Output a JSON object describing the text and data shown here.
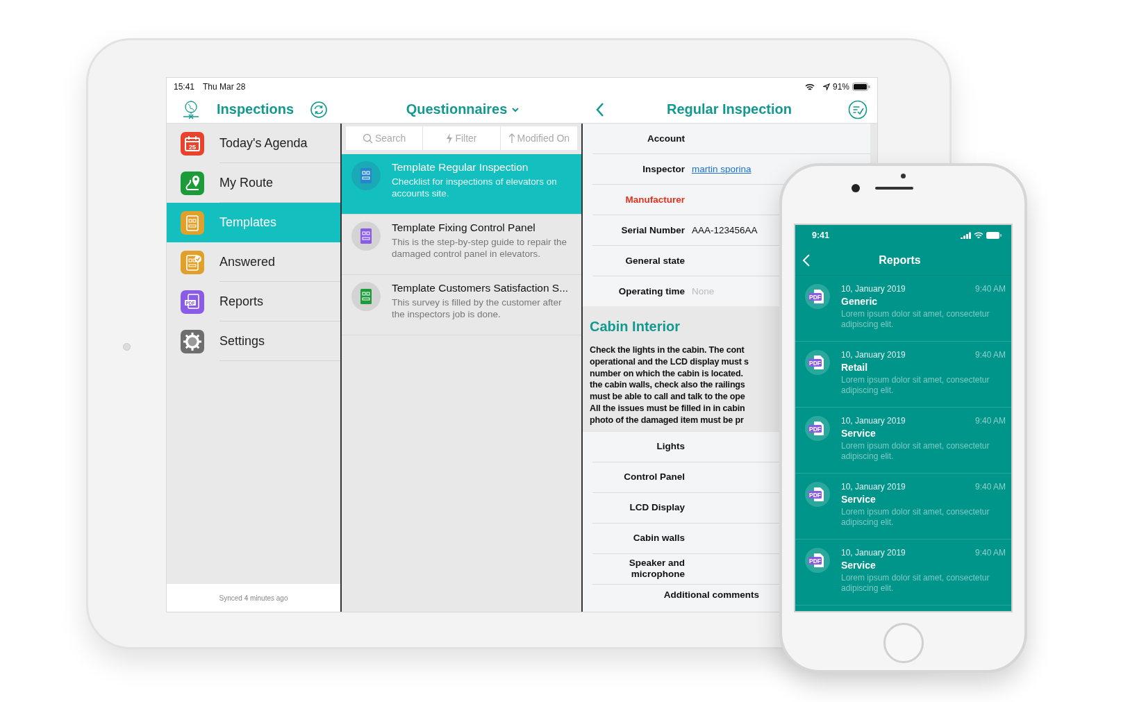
{
  "ipad": {
    "status_bar": {
      "time": "15:41",
      "date": "Thu Mar 28",
      "battery": "91%"
    },
    "sidebar": {
      "title": "Inspections",
      "items": [
        {
          "label": "Today's Agenda",
          "selected": false,
          "icon_label": "25"
        },
        {
          "label": "My Route",
          "selected": false
        },
        {
          "label": "Templates",
          "selected": true
        },
        {
          "label": "Answered",
          "selected": false
        },
        {
          "label": "Reports",
          "selected": false,
          "icon_label": "PDF"
        },
        {
          "label": "Settings",
          "selected": false
        }
      ],
      "footer": "Synced 4 minutes ago"
    },
    "list": {
      "title": "Questionnaires",
      "toolbar": [
        {
          "label": "Search"
        },
        {
          "label": "Filter"
        },
        {
          "label": "Modified On"
        }
      ],
      "items": [
        {
          "title": "Template Regular Inspection",
          "description": "Checklist for inspections of elevators on accounts site.",
          "selected": true
        },
        {
          "title": "Template Fixing Control Panel",
          "description": "This is the step-by-step guide to repair the damaged control panel in elevators.",
          "selected": false
        },
        {
          "title": "Template Customers Satisfaction S...",
          "description": "This survey is filled by the customer after the inspectors job is done.",
          "selected": false
        }
      ]
    },
    "detail": {
      "title": "Regular Inspection",
      "fields": [
        {
          "label": "Account",
          "required": false
        },
        {
          "label": "Inspector",
          "required": false,
          "value": "martin sporina",
          "kind": "link"
        },
        {
          "label": "Manufacturer",
          "required": true
        },
        {
          "label": "Serial Number",
          "required": false,
          "value": "AAA-123456AA",
          "kind": "text"
        },
        {
          "label": "General state",
          "required": false
        },
        {
          "label": "Operating time",
          "required": false,
          "placeholder": "None"
        }
      ],
      "section": {
        "title": "Cabin Interior",
        "description_lines": [
          "Check the lights in the cabin. The cont",
          "operational and the LCD display must s",
          "number on which the cabin is located.",
          "the cabin walls, check also the railings",
          "must be able to call and talk to the ope",
          "All the issues must be filled in in cabin",
          "photo of the damaged item must be pr"
        ],
        "fields": [
          {
            "label": "Lights"
          },
          {
            "label": "Control Panel"
          },
          {
            "label": "LCD Display"
          },
          {
            "label": "Cabin walls"
          },
          {
            "label": "Speaker and microphone"
          },
          {
            "label": "Additional comments"
          }
        ]
      }
    }
  },
  "iphone": {
    "status_bar": {
      "time": "9:41"
    },
    "title": "Reports",
    "reports": [
      {
        "date": "10, January 2019",
        "time": "9:40 AM",
        "title": "Generic",
        "description": "Lorem ipsum dolor sit amet, consectetur adipiscing elit.",
        "icon_label": "PDF"
      },
      {
        "date": "10, January 2019",
        "time": "9:40 AM",
        "title": "Retail",
        "description": "Lorem ipsum dolor sit amet, consectetur adipiscing elit.",
        "icon_label": "PDF"
      },
      {
        "date": "10, January 2019",
        "time": "9:40 AM",
        "title": "Service",
        "description": "Lorem ipsum dolor sit amet, consectetur adipiscing elit.",
        "icon_label": "PDF"
      },
      {
        "date": "10, January 2019",
        "time": "9:40 AM",
        "title": "Service",
        "description": "Lorem ipsum dolor sit amet, consectetur adipiscing elit.",
        "icon_label": "PDF"
      },
      {
        "date": "10, January 2019",
        "time": "9:40 AM",
        "title": "Service",
        "description": "Lorem ipsum dolor sit amet, consectetur adipiscing elit.",
        "icon_label": "PDF"
      }
    ]
  }
}
